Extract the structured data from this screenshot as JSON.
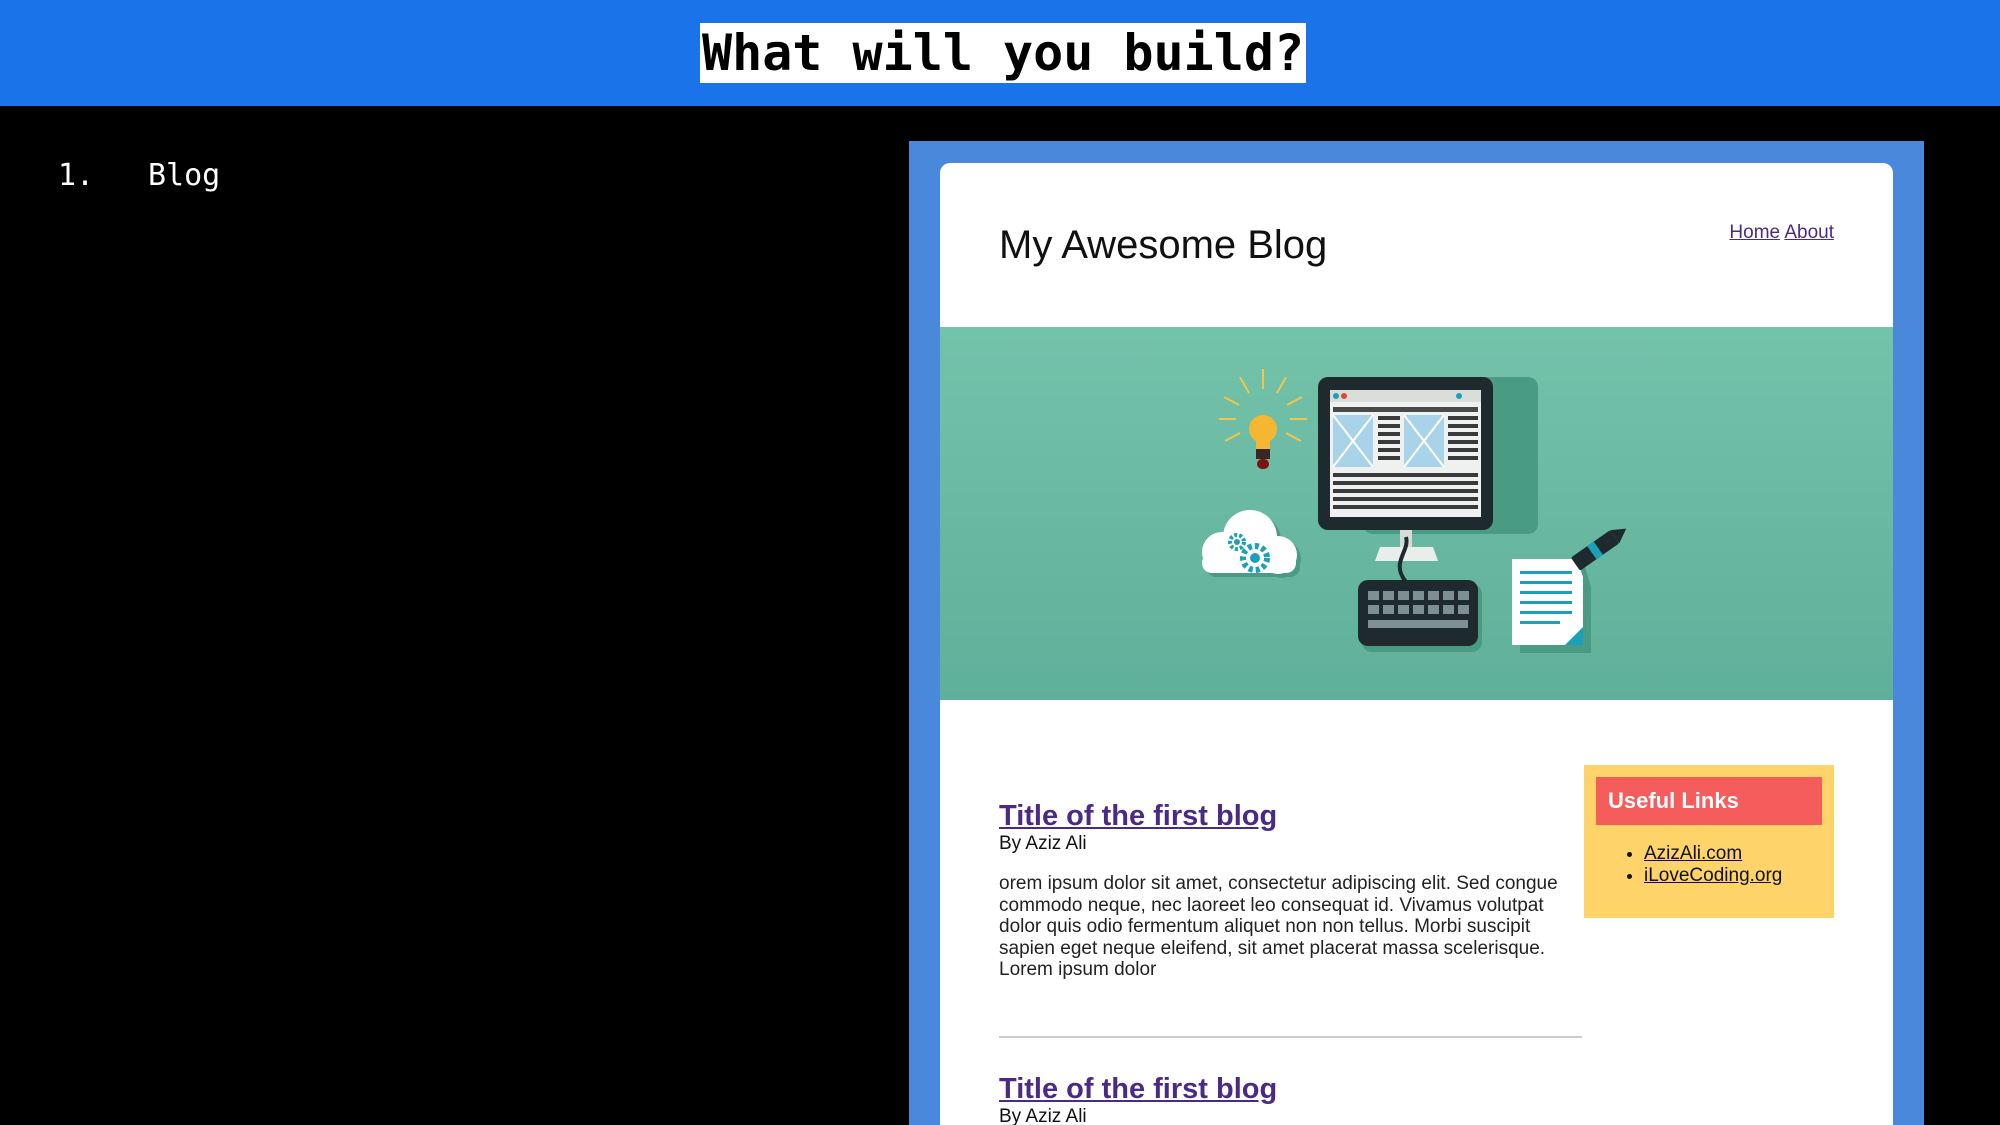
{
  "banner": {
    "title": "What will you build?"
  },
  "outline": {
    "items": [
      {
        "number": "1.",
        "label": "Blog"
      }
    ]
  },
  "blog": {
    "title": "My Awesome Blog",
    "nav": [
      "Home",
      "About"
    ],
    "posts": [
      {
        "title": "Title of the first blog",
        "author": "By Aziz Ali",
        "body": "orem ipsum dolor sit amet, consectetur adipiscing elit. Sed congue commodo neque, nec laoreet leo consequat id. Vivamus volutpat dolor quis odio fermentum aliquet non non tellus. Morbi suscipit sapien eget neque eleifend, sit amet placerat massa scelerisque. Lorem ipsum dolor"
      },
      {
        "title": "Title of the first blog",
        "author": "By Aziz Ali"
      }
    ],
    "sidebar": {
      "heading": "Useful Links",
      "links": [
        "AzizAli.com",
        "iLoveCoding.org"
      ]
    }
  },
  "colors": {
    "banner": "#1a73e8",
    "frame": "#4a88dc",
    "hero": "#6bbba3",
    "link": "#4b2a86",
    "sidebar": "#fdd36a",
    "sidebar_heading": "#f55c5c"
  },
  "icons": [
    "lightbulb-icon",
    "monitor-icon",
    "cloud-gear-icon",
    "keyboard-icon",
    "document-icon",
    "pen-icon"
  ]
}
